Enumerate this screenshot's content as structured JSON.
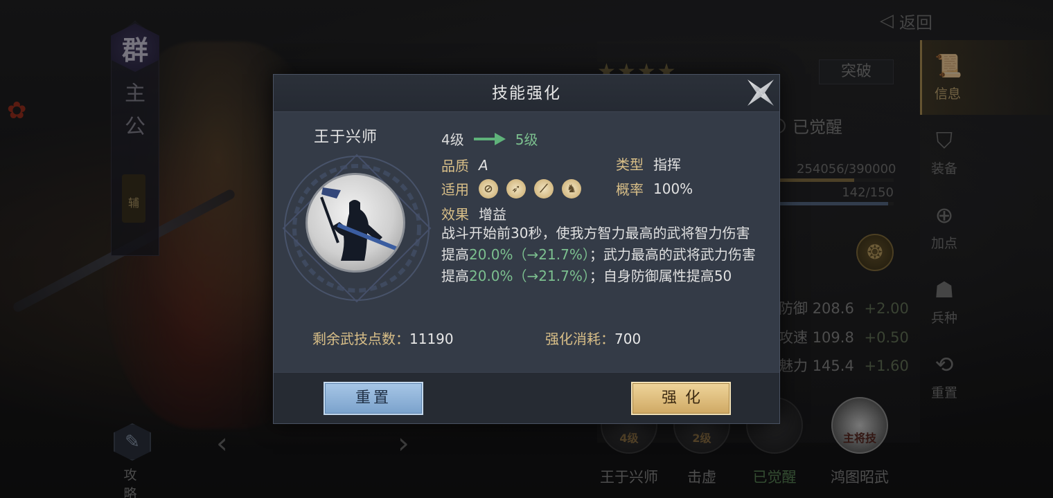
{
  "background": {
    "faction": {
      "emblem": "群",
      "title": "主公",
      "tag": "辅"
    },
    "guide_label": "攻 略",
    "back_label": "返回",
    "stars": "★★★★",
    "breakthrough_label": "突破",
    "awakened_label": "已觉醒",
    "exp_text": "254056/390000",
    "exp_progress": 0.65,
    "stamina_text": "142/150",
    "stamina_progress": 0.95,
    "stats": [
      {
        "label": "防御",
        "value": "208.6",
        "bonus": "+2.00"
      },
      {
        "label": "攻速",
        "value": "109.8",
        "bonus": "+0.50"
      },
      {
        "label": "魅力",
        "value": "145.4",
        "bonus": "+1.60"
      }
    ],
    "side_menu": [
      {
        "label": "信息",
        "icon": "scroll-icon"
      },
      {
        "label": "装备",
        "icon": "armor-icon"
      },
      {
        "label": "加点",
        "icon": "points-icon"
      },
      {
        "label": "兵种",
        "icon": "soldier-icon"
      },
      {
        "label": "重置",
        "icon": "reset-icon"
      }
    ],
    "skills": [
      {
        "name": "王于兴师",
        "level": "4级"
      },
      {
        "name": "击虚",
        "level": "2级"
      },
      {
        "name": "已觉醒",
        "level": ""
      },
      {
        "name": "鸿图昭武",
        "level": "主将技"
      }
    ]
  },
  "dialog": {
    "title": "技能强化",
    "skill_name": "王于兴师",
    "level_from": "4级",
    "level_to": "5级",
    "quality_label": "品质",
    "quality_value": "A",
    "type_label": "类型",
    "type_value": "指挥",
    "applies_label": "适用",
    "applies_icons": [
      "shield-icon",
      "bow-icon",
      "spear-icon",
      "horse-icon"
    ],
    "rate_label": "概率",
    "rate_value": "100%",
    "effect_label": "效果",
    "effect_value": "增益",
    "description": {
      "p1": "战斗开始前30秒，使我方智力最高的武将智力伤害提高",
      "hl1": "20.0%（→21.7%）",
      "p2": "；武力最高的武将武力伤害提高",
      "hl2": "20.0%（→21.7%）",
      "p3": "；自身防御属性提高50"
    },
    "remaining_points_label": "剩余武技点数：",
    "remaining_points_value": "11190",
    "cost_label": "强化消耗：",
    "cost_value": "700",
    "reset_label": "重置",
    "enhance_label": "强化"
  },
  "colors": {
    "highlight_green": "#7cc08f",
    "label_gold": "#d9bf88",
    "reset_blue": "#8fb4da",
    "enhance_gold": "#e0bf7e"
  }
}
